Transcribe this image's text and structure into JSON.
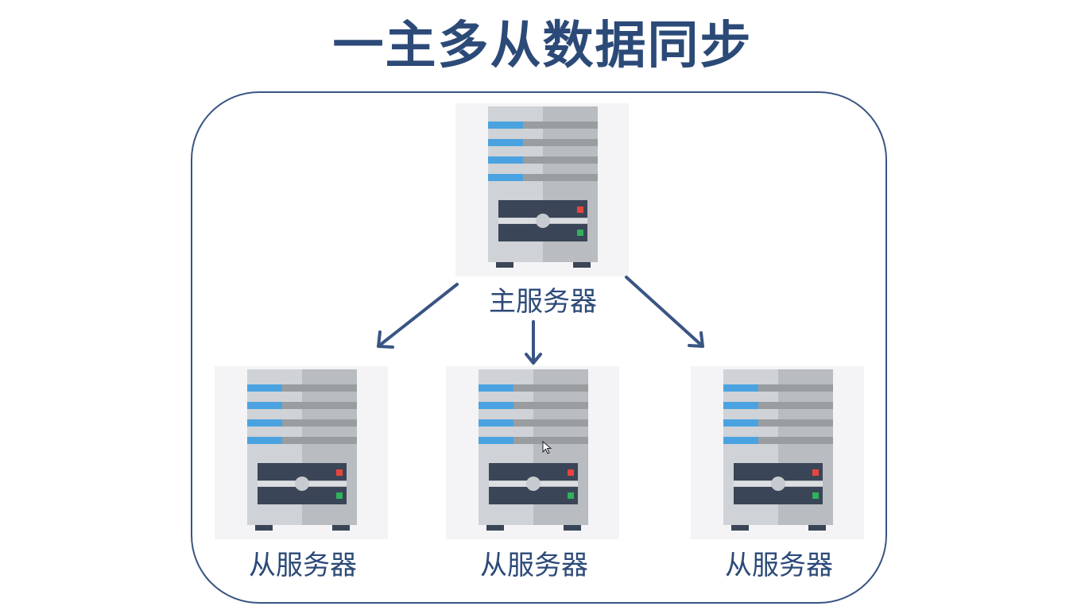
{
  "title": "一主多从数据同步",
  "colors": {
    "title": "#2c4a78",
    "frame": "#3a5583",
    "arrow": "#3a5583",
    "server_body_light": "#cfd2d6",
    "server_body_dark": "#b9bcc0",
    "server_slot_blue": "#4aa3e0",
    "server_slot_gray": "#9a9da0",
    "server_panel": "#3a4557",
    "led_red": "#e8453c",
    "led_green": "#2fb35a"
  },
  "nodes": {
    "master": {
      "label": "主服务器",
      "icon": "server-icon"
    },
    "slaves": [
      {
        "label": "从服务器",
        "icon": "server-icon"
      },
      {
        "label": "从服务器",
        "icon": "server-icon"
      },
      {
        "label": "从服务器",
        "icon": "server-icon"
      }
    ]
  }
}
